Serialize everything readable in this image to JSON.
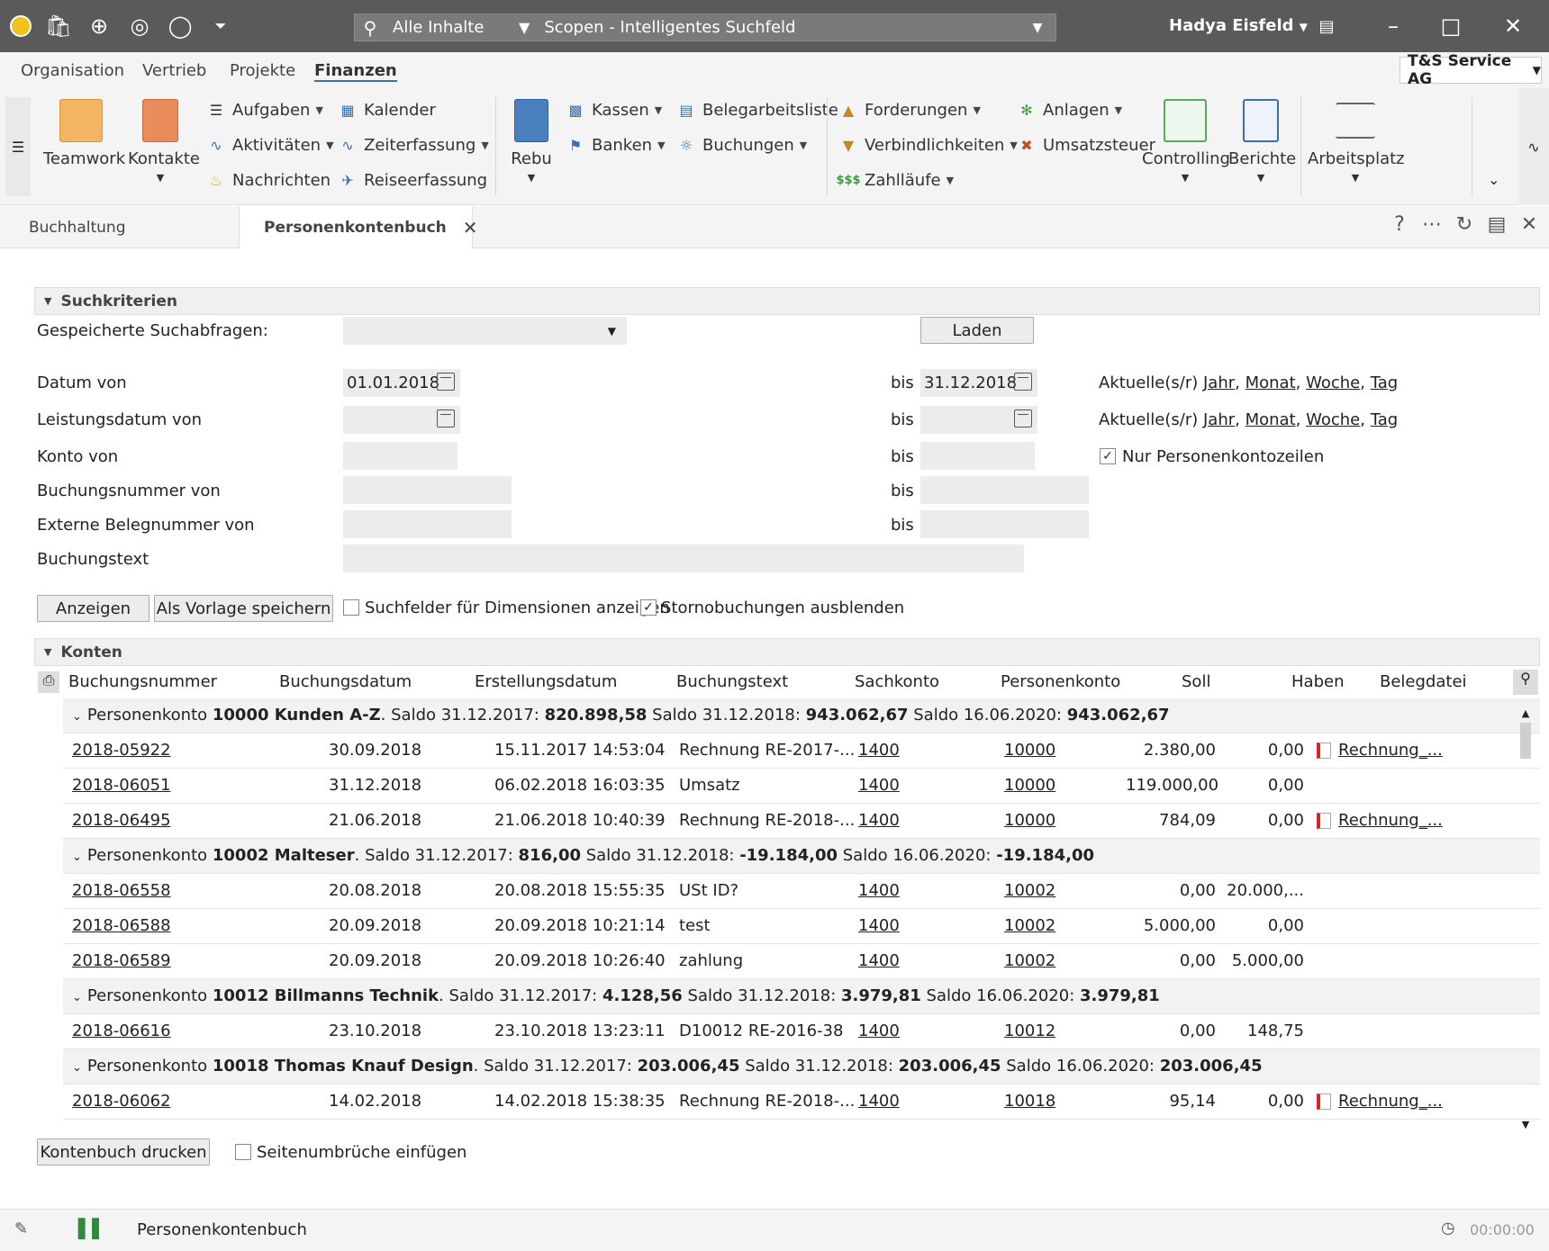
{
  "titlebar": {
    "search_scope": "Alle Inhalte",
    "search_placeholder": "Scopen - Intelligentes Suchfeld",
    "user": "Hadya Eisfeld"
  },
  "menu": [
    "Organisation",
    "Vertrieb",
    "Projekte",
    "Finanzen"
  ],
  "company": "T&S Service AG",
  "ribbon": {
    "teamwork": "Teamwork",
    "kontakte": "Kontakte",
    "aufgaben": "Aufgaben",
    "aktivitaeten": "Aktivitäten",
    "nachrichten": "Nachrichten",
    "kalender": "Kalender",
    "zeiterfassung": "Zeiterfassung",
    "reiseerfassung": "Reiseerfassung",
    "rebu": "Rebu",
    "kassen": "Kassen",
    "banken": "Banken",
    "belegarbeitsliste": "Belegarbeitsliste",
    "buchungen": "Buchungen",
    "forderungen": "Forderungen",
    "verbindlichkeiten": "Verbindlichkeiten",
    "zahllaeufe": "Zahlläufe",
    "anlagen": "Anlagen",
    "umsatzsteuer": "Umsatzsteuer",
    "controlling": "Controlling",
    "berichte": "Berichte",
    "arbeitsplatz": "Arbeitsplatz"
  },
  "tabs": [
    "Buchhaltung",
    "Personenkontenbuch"
  ],
  "search_section": {
    "title": "Suchkriterien",
    "saved_label": "Gespeicherte Suchabfragen:",
    "laden": "Laden",
    "datum_von": "Datum von",
    "datum_von_value": "01.01.2018",
    "bis": "bis",
    "datum_bis_value": "31.12.2018",
    "leistungsdatum": "Leistungsdatum von",
    "konto": "Konto von",
    "buchungsnummer": "Buchungsnummer von",
    "externe": "Externe Belegnummer von",
    "buchungstext": "Buchungstext",
    "aktuelle": "Aktuelle(s/r)",
    "jahr": "Jahr",
    "monat": "Monat",
    "woche": "Woche",
    "tag": "Tag",
    "nur_personen": "Nur Personenkontozeilen",
    "anzeigen": "Anzeigen",
    "als_vorlage": "Als Vorlage speichern",
    "dimensionen": "Suchfelder für Dimensionen anzeigen",
    "storno": "Stornobuchungen ausblenden"
  },
  "konten": {
    "title": "Konten",
    "columns": [
      "Buchungsnummer",
      "Buchungsdatum",
      "Erstellungsdatum",
      "Buchungstext",
      "Sachkonto",
      "Personenkonto",
      "Soll",
      "Haben",
      "Belegdatei"
    ],
    "groups": [
      {
        "prefix": "Personenkonto ",
        "name": "10000 Kunden A-Z",
        "s1": "Saldo 31.12.2017: ",
        "v1": "820.898,58",
        "s2": " Saldo 31.12.2018: ",
        "v2": "943.062,67",
        "s3": " Saldo 16.06.2020: ",
        "v3": "943.062,67",
        "rows": [
          [
            "2018-05922",
            "30.09.2018",
            "15.11.2017 14:53:04",
            "Rechnung RE-2017-...",
            "1400",
            "10000",
            "2.380,00",
            "0,00",
            "Rechnung_..."
          ],
          [
            "2018-06051",
            "31.12.2018",
            "06.02.2018 16:03:35",
            "Umsatz",
            "1400",
            "10000",
            "119.000,00",
            "0,00",
            ""
          ],
          [
            "2018-06495",
            "21.06.2018",
            "21.06.2018 10:40:39",
            "Rechnung RE-2018-...",
            "1400",
            "10000",
            "784,09",
            "0,00",
            "Rechnung_..."
          ]
        ]
      },
      {
        "prefix": "Personenkonto ",
        "name": "10002 Malteser",
        "s1": "Saldo 31.12.2017: ",
        "v1": "816,00",
        "s2": " Saldo 31.12.2018: ",
        "v2": "-19.184,00",
        "s3": " Saldo 16.06.2020: ",
        "v3": "-19.184,00",
        "rows": [
          [
            "2018-06558",
            "20.08.2018",
            "20.08.2018 15:55:35",
            "USt ID?",
            "1400",
            "10002",
            "0,00",
            "20.000,...",
            ""
          ],
          [
            "2018-06588",
            "20.09.2018",
            "20.09.2018 10:21:14",
            "test",
            "1400",
            "10002",
            "5.000,00",
            "0,00",
            ""
          ],
          [
            "2018-06589",
            "20.09.2018",
            "20.09.2018 10:26:40",
            "zahlung",
            "1400",
            "10002",
            "0,00",
            "5.000,00",
            ""
          ]
        ]
      },
      {
        "prefix": "Personenkonto ",
        "name": "10012 Billmanns Technik",
        "s1": "Saldo 31.12.2017: ",
        "v1": "4.128,56",
        "s2": " Saldo 31.12.2018: ",
        "v2": "3.979,81",
        "s3": " Saldo 16.06.2020: ",
        "v3": "3.979,81",
        "rows": [
          [
            "2018-06616",
            "23.10.2018",
            "23.10.2018 13:23:11",
            "D10012 RE-2016-38",
            "1400",
            "10012",
            "0,00",
            "148,75",
            ""
          ]
        ]
      },
      {
        "prefix": "Personenkonto ",
        "name": "10018 Thomas Knauf Design",
        "s1": "Saldo 31.12.2017: ",
        "v1": "203.006,45",
        "s2": " Saldo 31.12.2018: ",
        "v2": "203.006,45",
        "s3": " Saldo 16.06.2020: ",
        "v3": "203.006,45",
        "rows": [
          [
            "2018-06062",
            "14.02.2018",
            "14.02.2018 15:38:35",
            "Rechnung RE-2018-...",
            "1400",
            "10018",
            "95,14",
            "0,00",
            "Rechnung_..."
          ]
        ]
      }
    ]
  },
  "bottom": {
    "drucken": "Kontenbuch drucken",
    "seitenumbrueche": "Seitenumbrüche einfügen"
  },
  "status": {
    "label": "Personenkontenbuch",
    "timer": "00:00:00"
  }
}
